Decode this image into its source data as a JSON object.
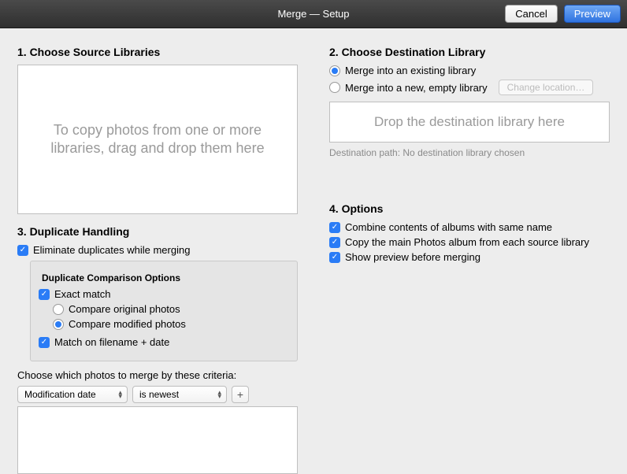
{
  "titlebar": {
    "title": "Merge — Setup",
    "cancel": "Cancel",
    "preview": "Preview"
  },
  "section1": {
    "title": "1. Choose Source Libraries",
    "drop_text": "To copy photos from one or more libraries, drag and drop them here"
  },
  "section2": {
    "title": "2. Choose Destination Library",
    "radio_existing": "Merge into an existing library",
    "radio_new": "Merge into a new, empty library",
    "change_location": "Change location…",
    "drop_text": "Drop the destination library here",
    "dest_path": "Destination path: No destination library chosen"
  },
  "section3": {
    "title": "3. Duplicate Handling",
    "eliminate": "Eliminate duplicates while merging",
    "comparison_title": "Duplicate Comparison Options",
    "exact_match": "Exact match",
    "compare_orig": "Compare original photos",
    "compare_mod": "Compare modified photos",
    "match_filename": "Match on filename + date",
    "criteria_label": "Choose which photos to merge by these criteria:",
    "select_field": "Modification date",
    "select_op": "is newest",
    "plus": "+"
  },
  "section4": {
    "title": "4. Options",
    "opt1": "Combine contents of albums with same name",
    "opt2": "Copy the main Photos album from each source library",
    "opt3": "Show preview before merging"
  }
}
